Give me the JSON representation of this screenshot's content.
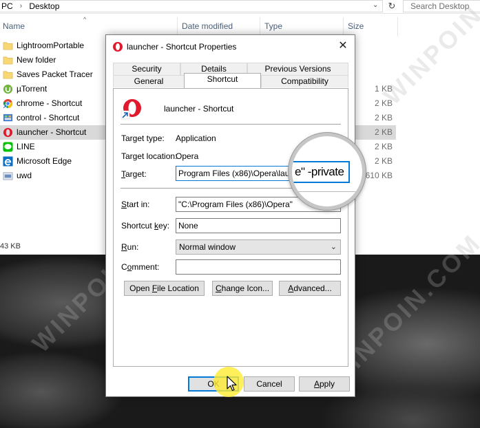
{
  "explorer": {
    "breadcrumb": {
      "prefix": "PC",
      "current": "Desktop"
    },
    "search_placeholder": "Search Desktop",
    "columns": {
      "name": "Name",
      "date": "Date modified",
      "type": "Type",
      "size": "Size"
    },
    "files": [
      {
        "name": "LightroomPortable",
        "size": "",
        "icon": "folder-icon"
      },
      {
        "name": "New folder",
        "size": "",
        "icon": "folder-icon"
      },
      {
        "name": "Saves Packet Tracer",
        "size": "",
        "icon": "folder-icon"
      },
      {
        "name": "µTorrent",
        "size": "1 KB",
        "icon": "utorrent-icon"
      },
      {
        "name": "chrome - Shortcut",
        "size": "2 KB",
        "icon": "chrome-icon"
      },
      {
        "name": "control - Shortcut",
        "size": "2 KB",
        "icon": "control-panel-icon"
      },
      {
        "name": "launcher - Shortcut",
        "size": "2 KB",
        "icon": "opera-icon"
      },
      {
        "name": "LINE",
        "size": "2 KB",
        "icon": "line-icon"
      },
      {
        "name": "Microsoft Edge",
        "size": "2 KB",
        "icon": "edge-icon"
      },
      {
        "name": "uwd",
        "size": "610 KB",
        "icon": "file-icon"
      }
    ],
    "status": "43 KB"
  },
  "dialog": {
    "title": "launcher - Shortcut Properties",
    "close_glyph": "✕",
    "tabs_top": [
      "Security",
      "Details",
      "Previous Versions"
    ],
    "tabs_bottom": [
      "General",
      "Shortcut",
      "Compatibility"
    ],
    "active_tab": "Shortcut",
    "shortcut_name": "launcher - Shortcut",
    "target_type_label": "Target type:",
    "target_type_value": "Application",
    "target_location_label": "Target location:",
    "target_location_value": "Opera",
    "target_label": "Target:",
    "target_value": "Program Files (x86)\\Opera\\launcher.exe\" -private",
    "start_in_label": "Start in:",
    "start_in_value": "\"C:\\Program Files (x86)\\Opera\"",
    "shortcut_key_label": "Shortcut key:",
    "shortcut_key_value": "None",
    "run_label": "Run:",
    "run_value": "Normal window",
    "comment_label": "Comment:",
    "comment_value": "",
    "open_location_button": "Open File Location",
    "change_icon_button": "Change Icon...",
    "advanced_button": "Advanced...",
    "ok_button": "OK",
    "cancel_button": "Cancel",
    "apply_button": "Apply"
  },
  "magnifier": {
    "text": "e\" -private"
  },
  "watermark": "WINPOIN.COM",
  "colors": {
    "accent": "#0078d7",
    "selected_row": "#d9d9d9",
    "cursor_highlight": "#ffec32",
    "opera_red": "#e0192e"
  }
}
